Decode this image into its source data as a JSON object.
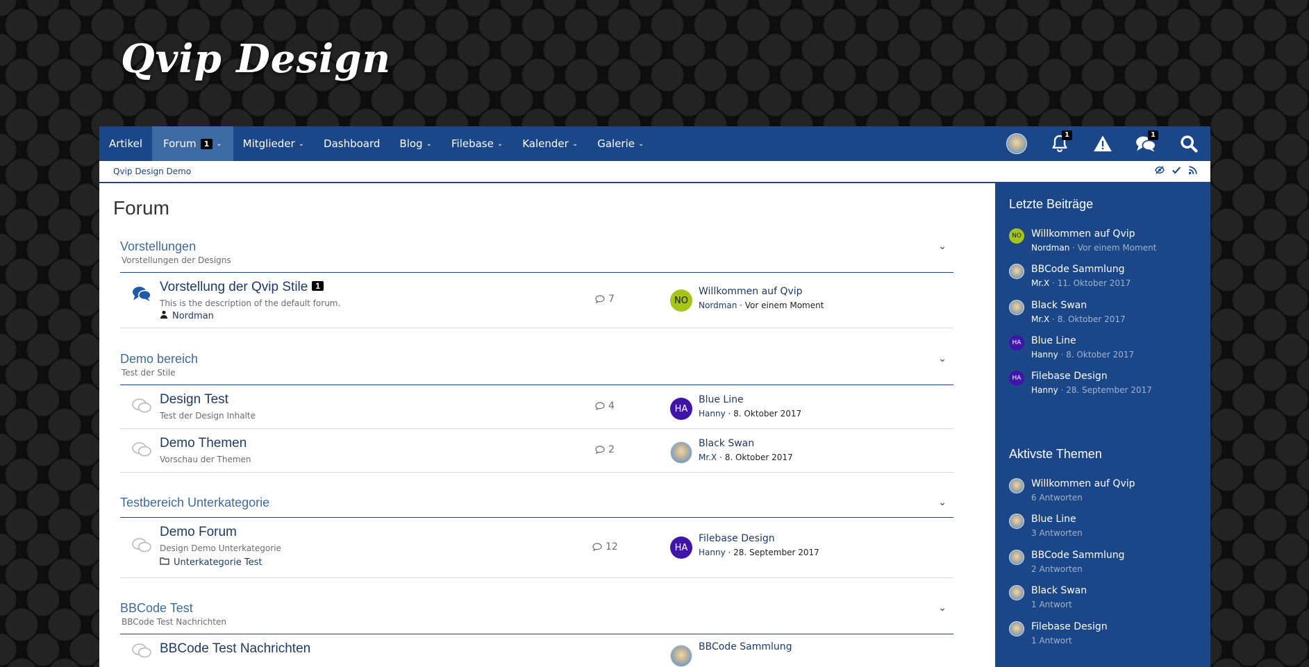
{
  "site": {
    "logo": "Qvip Design"
  },
  "nav": {
    "items": [
      {
        "label": "Artikel",
        "dropdown": false,
        "active": false
      },
      {
        "label": "Forum",
        "badge": "1",
        "dropdown": true,
        "active": true
      },
      {
        "label": "Mitglieder",
        "dropdown": true,
        "active": false
      },
      {
        "label": "Dashboard",
        "dropdown": false,
        "active": false
      },
      {
        "label": "Blog",
        "dropdown": true,
        "active": false
      },
      {
        "label": "Filebase",
        "dropdown": true,
        "active": false
      },
      {
        "label": "Kalender",
        "dropdown": true,
        "active": false
      },
      {
        "label": "Galerie",
        "dropdown": true,
        "active": false
      }
    ],
    "icons": {
      "notifications_badge": "1",
      "messages_badge": "1"
    }
  },
  "breadcrumb": {
    "label": "Qvip Design Demo"
  },
  "page": {
    "title": "Forum"
  },
  "categories": [
    {
      "title": "Vorstellungen",
      "desc": "Vorstellungen der Designs",
      "boards": [
        {
          "title": "Vorstellung der Qvip Stile",
          "badge": "1",
          "desc": "This is the description of the default forum.",
          "moderator": "Nordman",
          "count": "7",
          "last": {
            "title": "Willkommen auf Qvip",
            "user": "Nordman",
            "date": "Vor einem Moment",
            "initials": "NO",
            "avatar_color": "#a5c51a"
          }
        }
      ]
    },
    {
      "title": "Demo bereich",
      "desc": "Test der Stile",
      "boards": [
        {
          "title": "Design Test",
          "desc": "Test der Design Inhalte",
          "count": "4",
          "last": {
            "title": "Blue Line",
            "user": "Hanny",
            "date": "8. Oktober 2017",
            "initials": "HA",
            "avatar_color": "#3f14a8"
          }
        },
        {
          "title": "Demo Themen",
          "desc": "Vorschau der Themen",
          "count": "2",
          "last": {
            "title": "Black Swan",
            "user": "Mr.X",
            "date": "8. Oktober 2017",
            "initials": "",
            "avatar_color": "ship"
          }
        }
      ]
    },
    {
      "title": "Testbereich Unterkategorie",
      "desc": "",
      "boards": [
        {
          "title": "Demo Forum",
          "desc": "Design Demo Unterkategorie",
          "subforum": "Unterkategorie Test",
          "count": "12",
          "last": {
            "title": "Filebase Design",
            "user": "Hanny",
            "date": "28. September 2017",
            "initials": "HA",
            "avatar_color": "#3f14a8"
          }
        }
      ]
    },
    {
      "title": "BBCode Test",
      "desc": "BBCode Test Nachrichten",
      "boards": [
        {
          "title": "BBCode Test Nachrichten",
          "last": {
            "title": "BBCode Sammlung"
          }
        }
      ]
    }
  ],
  "sidebar": {
    "latest": {
      "title": "Letzte Beiträge",
      "items": [
        {
          "title": "Willkommen auf Qvip",
          "user": "Nordman",
          "date": "Vor einem Moment",
          "initials": "NO",
          "avatar_color": "#a5c51a"
        },
        {
          "title": "BBCode Sammlung",
          "user": "Mr.X",
          "date": "11. Oktober 2017",
          "initials": "",
          "avatar_color": "ship"
        },
        {
          "title": "Black Swan",
          "user": "Mr.X",
          "date": "8. Oktober 2017",
          "initials": "",
          "avatar_color": "ship"
        },
        {
          "title": "Blue Line",
          "user": "Hanny",
          "date": "8. Oktober 2017",
          "initials": "HA",
          "avatar_color": "#3f14a8"
        },
        {
          "title": "Filebase Design",
          "user": "Hanny",
          "date": "28. September 2017",
          "initials": "HA",
          "avatar_color": "#3f14a8"
        }
      ]
    },
    "active": {
      "title": "Aktivste Themen",
      "items": [
        {
          "title": "Willkommen auf Qvip",
          "meta": "6 Antworten"
        },
        {
          "title": "Blue Line",
          "meta": "3 Antworten"
        },
        {
          "title": "BBCode Sammlung",
          "meta": "2 Antworten"
        },
        {
          "title": "Black Swan",
          "meta": "1 Antwort"
        },
        {
          "title": "Filebase Design",
          "meta": "1 Antwort"
        }
      ]
    }
  }
}
